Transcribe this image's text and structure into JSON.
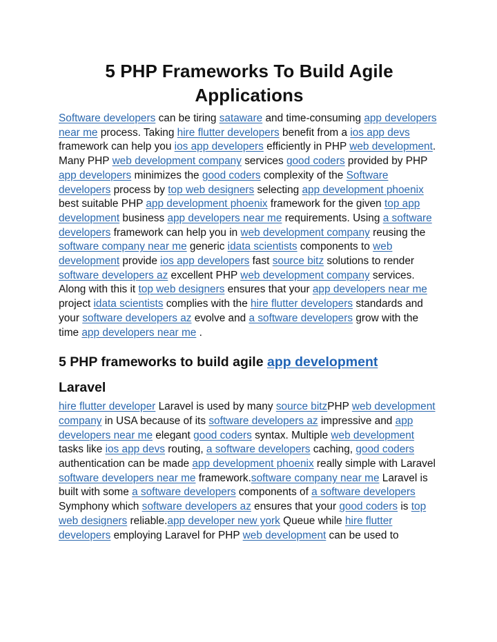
{
  "document": {
    "title": "5 PHP Frameworks To Build Agile Applications",
    "link_color": "#2b68ae",
    "text_color": "#111111",
    "intro_paragraph": [
      {
        "type": "link",
        "text": "Software developers"
      },
      {
        "type": "text",
        "text": " can be tiring "
      },
      {
        "type": "link",
        "text": "sataware"
      },
      {
        "type": "text",
        "text": " and time-consuming "
      },
      {
        "type": "link",
        "text": "app developers near me"
      },
      {
        "type": "text",
        "text": " process. Taking "
      },
      {
        "type": "link",
        "text": "hire flutter developers"
      },
      {
        "type": "text",
        "text": " benefit from a "
      },
      {
        "type": "link",
        "text": "ios app devs"
      },
      {
        "type": "text",
        "text": " framework can help you "
      },
      {
        "type": "link",
        "text": "ios app developers"
      },
      {
        "type": "text",
        "text": " efficiently in PHP "
      },
      {
        "type": "link",
        "text": "web development"
      },
      {
        "type": "text",
        "text": ". Many PHP "
      },
      {
        "type": "link",
        "text": "web development company"
      },
      {
        "type": "text",
        "text": " services "
      },
      {
        "type": "link",
        "text": "good coders"
      },
      {
        "type": "text",
        "text": " provided by PHP "
      },
      {
        "type": "link",
        "text": "app developers"
      },
      {
        "type": "text",
        "text": " minimizes the "
      },
      {
        "type": "link",
        "text": "good coders"
      },
      {
        "type": "text",
        "text": " complexity of the "
      },
      {
        "type": "link",
        "text": "Software developers"
      },
      {
        "type": "text",
        "text": " process by "
      },
      {
        "type": "link",
        "text": "top web designers"
      },
      {
        "type": "text",
        "text": " selecting "
      },
      {
        "type": "link",
        "text": "app development phoenix"
      },
      {
        "type": "text",
        "text": " best suitable PHP "
      },
      {
        "type": "link",
        "text": "app development phoenix"
      },
      {
        "type": "text",
        "text": " framework for the given "
      },
      {
        "type": "link",
        "text": "top app development"
      },
      {
        "type": "text",
        "text": " business "
      },
      {
        "type": "link",
        "text": "app developers near me"
      },
      {
        "type": "text",
        "text": " requirements. Using "
      },
      {
        "type": "link",
        "text": "a software developers"
      },
      {
        "type": "text",
        "text": " framework can help you in "
      },
      {
        "type": "link",
        "text": "web development company"
      },
      {
        "type": "text",
        "text": " reusing the "
      },
      {
        "type": "link",
        "text": "software company near me"
      },
      {
        "type": "text",
        "text": " generic "
      },
      {
        "type": "link",
        "text": "idata scientists"
      },
      {
        "type": "text",
        "text": " components to "
      },
      {
        "type": "link",
        "text": "web development"
      },
      {
        "type": "text",
        "text": " provide "
      },
      {
        "type": "link",
        "text": "ios app developers"
      },
      {
        "type": "text",
        "text": " fast "
      },
      {
        "type": "link",
        "text": "source bitz"
      },
      {
        "type": "text",
        "text": " solutions to render "
      },
      {
        "type": "link",
        "text": "software developers az"
      },
      {
        "type": "text",
        "text": " excellent PHP "
      },
      {
        "type": "link",
        "text": "web development company"
      },
      {
        "type": "text",
        "text": " services. Along with this it "
      },
      {
        "type": "link",
        "text": "top web designers"
      },
      {
        "type": "text",
        "text": " ensures that your "
      },
      {
        "type": "link",
        "text": "app developers near me"
      },
      {
        "type": "text",
        "text": " project "
      },
      {
        "type": "link",
        "text": "idata scientists"
      },
      {
        "type": "text",
        "text": " complies with the "
      },
      {
        "type": "link",
        "text": "hire flutter developers"
      },
      {
        "type": "text",
        "text": " standards and your "
      },
      {
        "type": "link",
        "text": "software developers az"
      },
      {
        "type": "text",
        "text": " evolve and "
      },
      {
        "type": "link",
        "text": "a software developers"
      },
      {
        "type": "text",
        "text": "  grow with the time "
      },
      {
        "type": "link",
        "text": "app developers near me"
      },
      {
        "type": "text",
        "text": " ."
      }
    ],
    "section_heading": {
      "text": "5 PHP frameworks to build agile ",
      "link": "app development"
    },
    "laravel_heading": "Laravel",
    "laravel_paragraph": [
      {
        "type": "link",
        "text": "hire flutter developer"
      },
      {
        "type": "text",
        "text": " Laravel is used by many "
      },
      {
        "type": "link",
        "text": "source bitz"
      },
      {
        "type": "text",
        "text": "PHP "
      },
      {
        "type": "link",
        "text": "web development company"
      },
      {
        "type": "text",
        "text": " in USA because of its "
      },
      {
        "type": "link",
        "text": "software developers az"
      },
      {
        "type": "text",
        "text": " impressive and "
      },
      {
        "type": "link",
        "text": "app developers near me"
      },
      {
        "type": "text",
        "text": " elegant "
      },
      {
        "type": "link",
        "text": "good coders"
      },
      {
        "type": "text",
        "text": " syntax. Multiple "
      },
      {
        "type": "link",
        "text": "web development"
      },
      {
        "type": "text",
        "text": " tasks like "
      },
      {
        "type": "link",
        "text": "ios app devs"
      },
      {
        "type": "text",
        "text": " routing, "
      },
      {
        "type": "link",
        "text": "a software developers"
      },
      {
        "type": "text",
        "text": " caching, "
      },
      {
        "type": "link",
        "text": "good coders"
      },
      {
        "type": "text",
        "text": " authentication can be made "
      },
      {
        "type": "link",
        "text": "app development phoenix"
      },
      {
        "type": "text",
        "text": " really simple with Laravel "
      },
      {
        "type": "link",
        "text": "software developers near me"
      },
      {
        "type": "text",
        "text": " framework."
      },
      {
        "type": "link",
        "text": "software company near me"
      },
      {
        "type": "text",
        "text": " Laravel is built with some "
      },
      {
        "type": "link",
        "text": "a software developers"
      },
      {
        "type": "text",
        "text": "  components of "
      },
      {
        "type": "link",
        "text": "a software developers"
      },
      {
        "type": "text",
        "text": "  Symphony which "
      },
      {
        "type": "link",
        "text": "software developers az"
      },
      {
        "type": "text",
        "text": " ensures that your "
      },
      {
        "type": "link",
        "text": "good coders"
      },
      {
        "type": "text",
        "text": " is "
      },
      {
        "type": "link",
        "text": "top web designers"
      },
      {
        "type": "text",
        "text": " reliable."
      },
      {
        "type": "link",
        "text": "app developer new york"
      },
      {
        "type": "text",
        "text": " Queue while "
      },
      {
        "type": "link",
        "text": "hire flutter developers"
      },
      {
        "type": "text",
        "text": " employing Laravel for PHP "
      },
      {
        "type": "link",
        "text": "web development"
      },
      {
        "type": "text",
        "text": " can be used to"
      }
    ]
  }
}
